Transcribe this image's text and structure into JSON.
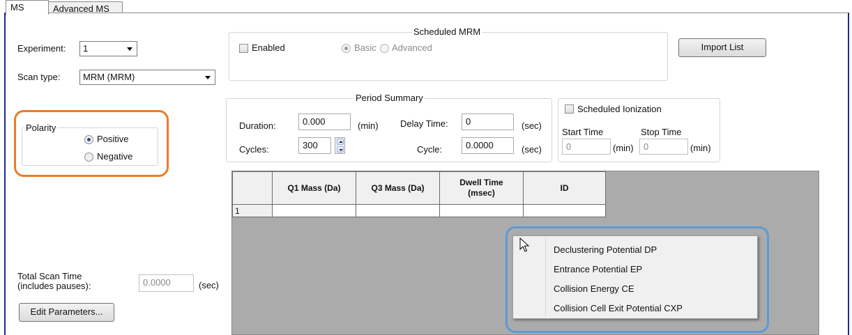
{
  "tabs": [
    {
      "label": "MS",
      "active": true
    },
    {
      "label": "Advanced MS",
      "active": false
    }
  ],
  "experiment": {
    "label": "Experiment:",
    "value": "1"
  },
  "scan_type": {
    "label": "Scan type:",
    "value": "MRM (MRM)"
  },
  "polarity": {
    "title": "Polarity",
    "options": [
      {
        "label": "Positive",
        "selected": true
      },
      {
        "label": "Negative",
        "selected": false
      }
    ]
  },
  "scheduled_mrm": {
    "title": "Scheduled MRM",
    "enabled_label": "Enabled",
    "enabled_checked": false,
    "basic_label": "Basic",
    "advanced_label": "Advanced",
    "selected": "Basic"
  },
  "import_list_label": "Import List",
  "period_summary": {
    "title": "Period Summary",
    "duration_label": "Duration:",
    "duration_value": "0.000",
    "duration_unit": "(min)",
    "delay_label": "Delay Time:",
    "delay_value": "0",
    "delay_unit": "(sec)",
    "cycles_label": "Cycles:",
    "cycles_value": "300",
    "cycle_label": "Cycle:",
    "cycle_value": "0.0000",
    "cycle_unit": "(sec)"
  },
  "scheduled_ionization": {
    "label": "Scheduled Ionization",
    "checked": false,
    "start_label": "Start Time",
    "start_value": "0",
    "start_unit": "(min)",
    "stop_label": "Stop Time",
    "stop_value": "0",
    "stop_unit": "(min)"
  },
  "table": {
    "columns": [
      "Q1 Mass (Da)",
      "Q3 Mass (Da)",
      "Dwell Time (msec)",
      "ID"
    ],
    "rows": [
      {
        "num": "1",
        "cells": [
          "",
          "",
          "",
          ""
        ]
      }
    ]
  },
  "context_menu": {
    "items": [
      "Declustering Potential DP",
      "Entrance Potential EP",
      "Collision Energy CE",
      "Collision Cell Exit Potential CXP"
    ]
  },
  "total_scan": {
    "label_line1": "Total Scan Time",
    "label_line2": "(includes pauses):",
    "value": "0.0000",
    "unit": "(sec)"
  },
  "edit_parameters_label": "Edit Parameters...",
  "colors": {
    "frame_border": "#1c2a8c",
    "highlight_orange": "#e87d2c",
    "highlight_blue": "#5b9bd5",
    "grid_background": "#ababab"
  }
}
